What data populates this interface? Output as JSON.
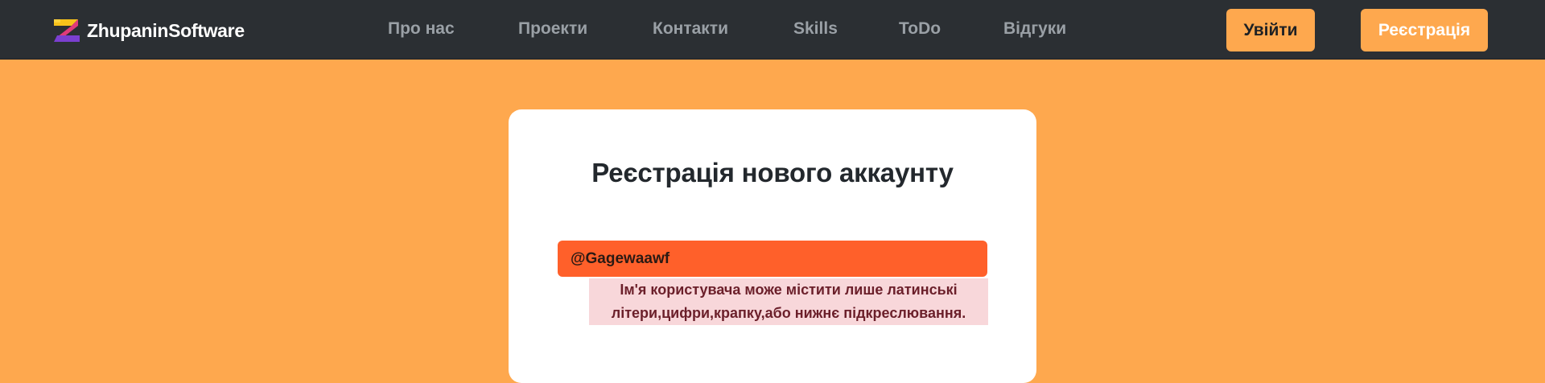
{
  "brand": {
    "name": "ZhupaninSoftware",
    "icon": "logo-icon",
    "colors": {
      "yellow": "#f7c21a",
      "pink": "#e03a7a",
      "purple": "#7b3fd0"
    }
  },
  "nav": {
    "links": [
      {
        "label": "Про нас",
        "id": "about"
      },
      {
        "label": "Проекти",
        "id": "projects"
      },
      {
        "label": "Контакти",
        "id": "contacts"
      },
      {
        "label": "Skills",
        "id": "skills"
      },
      {
        "label": "ToDo",
        "id": "todo"
      },
      {
        "label": "Відгуки",
        "id": "reviews"
      }
    ],
    "login_label": "Увійти",
    "register_label": "Реєстрація"
  },
  "form": {
    "title": "Реєстрація нового аккаунту",
    "username_value": "@Gagewaawf",
    "error_message": "Ім'я користувача може містити лише латинські літери,цифри,крапку,або нижнє підкреслювання."
  },
  "colors": {
    "navbar_bg": "#2b2f33",
    "page_bg": "#fea84e",
    "accent": "#fea84e",
    "input_error_bg": "#ff602a",
    "error_box_bg": "#f8d7da",
    "error_text": "#6b1f2a"
  }
}
